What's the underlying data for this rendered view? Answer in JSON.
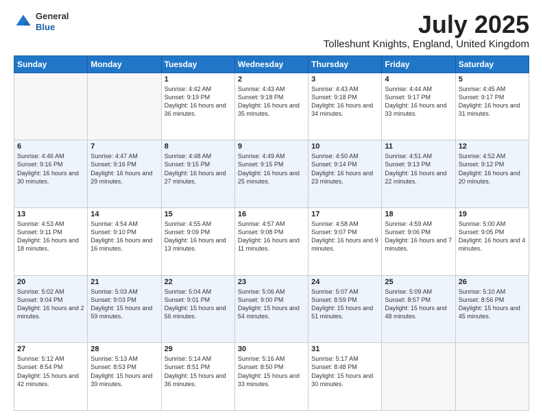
{
  "header": {
    "logo_general": "General",
    "logo_blue": "Blue",
    "month_title": "July 2025",
    "location": "Tolleshunt Knights, England, United Kingdom"
  },
  "weekdays": [
    "Sunday",
    "Monday",
    "Tuesday",
    "Wednesday",
    "Thursday",
    "Friday",
    "Saturday"
  ],
  "weeks": [
    [
      {
        "day": "",
        "sunrise": "",
        "sunset": "",
        "daylight": ""
      },
      {
        "day": "",
        "sunrise": "",
        "sunset": "",
        "daylight": ""
      },
      {
        "day": "1",
        "sunrise": "Sunrise: 4:42 AM",
        "sunset": "Sunset: 9:19 PM",
        "daylight": "Daylight: 16 hours and 36 minutes."
      },
      {
        "day": "2",
        "sunrise": "Sunrise: 4:43 AM",
        "sunset": "Sunset: 9:18 PM",
        "daylight": "Daylight: 16 hours and 35 minutes."
      },
      {
        "day": "3",
        "sunrise": "Sunrise: 4:43 AM",
        "sunset": "Sunset: 9:18 PM",
        "daylight": "Daylight: 16 hours and 34 minutes."
      },
      {
        "day": "4",
        "sunrise": "Sunrise: 4:44 AM",
        "sunset": "Sunset: 9:17 PM",
        "daylight": "Daylight: 16 hours and 33 minutes."
      },
      {
        "day": "5",
        "sunrise": "Sunrise: 4:45 AM",
        "sunset": "Sunset: 9:17 PM",
        "daylight": "Daylight: 16 hours and 31 minutes."
      }
    ],
    [
      {
        "day": "6",
        "sunrise": "Sunrise: 4:46 AM",
        "sunset": "Sunset: 9:16 PM",
        "daylight": "Daylight: 16 hours and 30 minutes."
      },
      {
        "day": "7",
        "sunrise": "Sunrise: 4:47 AM",
        "sunset": "Sunset: 9:16 PM",
        "daylight": "Daylight: 16 hours and 29 minutes."
      },
      {
        "day": "8",
        "sunrise": "Sunrise: 4:48 AM",
        "sunset": "Sunset: 9:15 PM",
        "daylight": "Daylight: 16 hours and 27 minutes."
      },
      {
        "day": "9",
        "sunrise": "Sunrise: 4:49 AM",
        "sunset": "Sunset: 9:15 PM",
        "daylight": "Daylight: 16 hours and 25 minutes."
      },
      {
        "day": "10",
        "sunrise": "Sunrise: 4:50 AM",
        "sunset": "Sunset: 9:14 PM",
        "daylight": "Daylight: 16 hours and 23 minutes."
      },
      {
        "day": "11",
        "sunrise": "Sunrise: 4:51 AM",
        "sunset": "Sunset: 9:13 PM",
        "daylight": "Daylight: 16 hours and 22 minutes."
      },
      {
        "day": "12",
        "sunrise": "Sunrise: 4:52 AM",
        "sunset": "Sunset: 9:12 PM",
        "daylight": "Daylight: 16 hours and 20 minutes."
      }
    ],
    [
      {
        "day": "13",
        "sunrise": "Sunrise: 4:53 AM",
        "sunset": "Sunset: 9:11 PM",
        "daylight": "Daylight: 16 hours and 18 minutes."
      },
      {
        "day": "14",
        "sunrise": "Sunrise: 4:54 AM",
        "sunset": "Sunset: 9:10 PM",
        "daylight": "Daylight: 16 hours and 16 minutes."
      },
      {
        "day": "15",
        "sunrise": "Sunrise: 4:55 AM",
        "sunset": "Sunset: 9:09 PM",
        "daylight": "Daylight: 16 hours and 13 minutes."
      },
      {
        "day": "16",
        "sunrise": "Sunrise: 4:57 AM",
        "sunset": "Sunset: 9:08 PM",
        "daylight": "Daylight: 16 hours and 11 minutes."
      },
      {
        "day": "17",
        "sunrise": "Sunrise: 4:58 AM",
        "sunset": "Sunset: 9:07 PM",
        "daylight": "Daylight: 16 hours and 9 minutes."
      },
      {
        "day": "18",
        "sunrise": "Sunrise: 4:59 AM",
        "sunset": "Sunset: 9:06 PM",
        "daylight": "Daylight: 16 hours and 7 minutes."
      },
      {
        "day": "19",
        "sunrise": "Sunrise: 5:00 AM",
        "sunset": "Sunset: 9:05 PM",
        "daylight": "Daylight: 16 hours and 4 minutes."
      }
    ],
    [
      {
        "day": "20",
        "sunrise": "Sunrise: 5:02 AM",
        "sunset": "Sunset: 9:04 PM",
        "daylight": "Daylight: 16 hours and 2 minutes."
      },
      {
        "day": "21",
        "sunrise": "Sunrise: 5:03 AM",
        "sunset": "Sunset: 9:03 PM",
        "daylight": "Daylight: 15 hours and 59 minutes."
      },
      {
        "day": "22",
        "sunrise": "Sunrise: 5:04 AM",
        "sunset": "Sunset: 9:01 PM",
        "daylight": "Daylight: 15 hours and 56 minutes."
      },
      {
        "day": "23",
        "sunrise": "Sunrise: 5:06 AM",
        "sunset": "Sunset: 9:00 PM",
        "daylight": "Daylight: 15 hours and 54 minutes."
      },
      {
        "day": "24",
        "sunrise": "Sunrise: 5:07 AM",
        "sunset": "Sunset: 8:59 PM",
        "daylight": "Daylight: 15 hours and 51 minutes."
      },
      {
        "day": "25",
        "sunrise": "Sunrise: 5:09 AM",
        "sunset": "Sunset: 8:57 PM",
        "daylight": "Daylight: 15 hours and 48 minutes."
      },
      {
        "day": "26",
        "sunrise": "Sunrise: 5:10 AM",
        "sunset": "Sunset: 8:56 PM",
        "daylight": "Daylight: 15 hours and 45 minutes."
      }
    ],
    [
      {
        "day": "27",
        "sunrise": "Sunrise: 5:12 AM",
        "sunset": "Sunset: 8:54 PM",
        "daylight": "Daylight: 15 hours and 42 minutes."
      },
      {
        "day": "28",
        "sunrise": "Sunrise: 5:13 AM",
        "sunset": "Sunset: 8:53 PM",
        "daylight": "Daylight: 15 hours and 39 minutes."
      },
      {
        "day": "29",
        "sunrise": "Sunrise: 5:14 AM",
        "sunset": "Sunset: 8:51 PM",
        "daylight": "Daylight: 15 hours and 36 minutes."
      },
      {
        "day": "30",
        "sunrise": "Sunrise: 5:16 AM",
        "sunset": "Sunset: 8:50 PM",
        "daylight": "Daylight: 15 hours and 33 minutes."
      },
      {
        "day": "31",
        "sunrise": "Sunrise: 5:17 AM",
        "sunset": "Sunset: 8:48 PM",
        "daylight": "Daylight: 15 hours and 30 minutes."
      },
      {
        "day": "",
        "sunrise": "",
        "sunset": "",
        "daylight": ""
      },
      {
        "day": "",
        "sunrise": "",
        "sunset": "",
        "daylight": ""
      }
    ]
  ]
}
